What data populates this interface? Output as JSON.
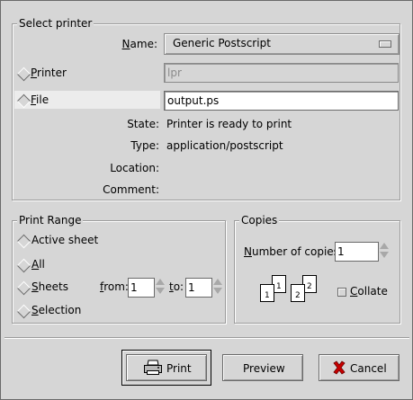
{
  "select_printer": {
    "title": "Select printer",
    "name_label": "Name:",
    "name_value": "Generic Postscript",
    "printer_label": "Printer",
    "printer_value": "lpr",
    "file_label": "File",
    "file_value": "output.ps",
    "state_label": "State:",
    "state_value": "Printer is ready to print",
    "type_label": "Type:",
    "type_value": "application/postscript",
    "location_label": "Location:",
    "location_value": "",
    "comment_label": "Comment:",
    "comment_value": ""
  },
  "print_range": {
    "title": "Print Range",
    "active_sheet_label": "Active sheet",
    "all_label": "All",
    "sheets_label": "Sheets",
    "selection_label": "Selection",
    "from_label": "from:",
    "from_value": "1",
    "to_label": "to:",
    "to_value": "1"
  },
  "copies": {
    "title": "Copies",
    "number_label": "Number of copies:",
    "number_value": "1",
    "collate_label": "Collate",
    "collate_checked": false,
    "page_numbers": [
      "1",
      "1",
      "2",
      "2"
    ]
  },
  "buttons": {
    "print": "Print",
    "preview": "Preview",
    "cancel": "Cancel"
  },
  "icons": {
    "printer": "printer-icon",
    "cancel": "cancel-x-icon",
    "collate": "collate-pages-icon"
  },
  "colors": {
    "background": "#d6d6d6",
    "cancel_x": "#c80000"
  }
}
